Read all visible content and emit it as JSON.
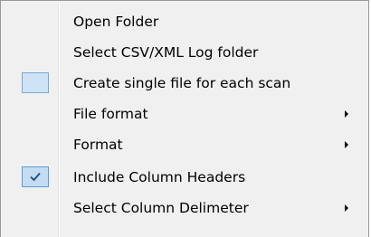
{
  "menu": {
    "items": [
      {
        "label": "Open Folder"
      },
      {
        "label": "Select CSV/XML Log folder"
      },
      {
        "label": "Create single file for each scan",
        "checked": false
      },
      {
        "label": "File format",
        "submenu": true
      },
      {
        "label": "Format",
        "submenu": true
      },
      {
        "label": "Include Column Headers",
        "checked": true
      },
      {
        "label": "Select Column Delimeter",
        "submenu": true
      }
    ]
  },
  "colors": {
    "menu_bg": "#f0f0f0",
    "menu_border": "#979797",
    "check_fill": "#c4dcf2",
    "check_border": "#5b9bd5",
    "check_mark": "#1c4d86"
  },
  "icons": {
    "checkmark": "checkmark-icon",
    "submenu": "chevron-right-icon"
  }
}
